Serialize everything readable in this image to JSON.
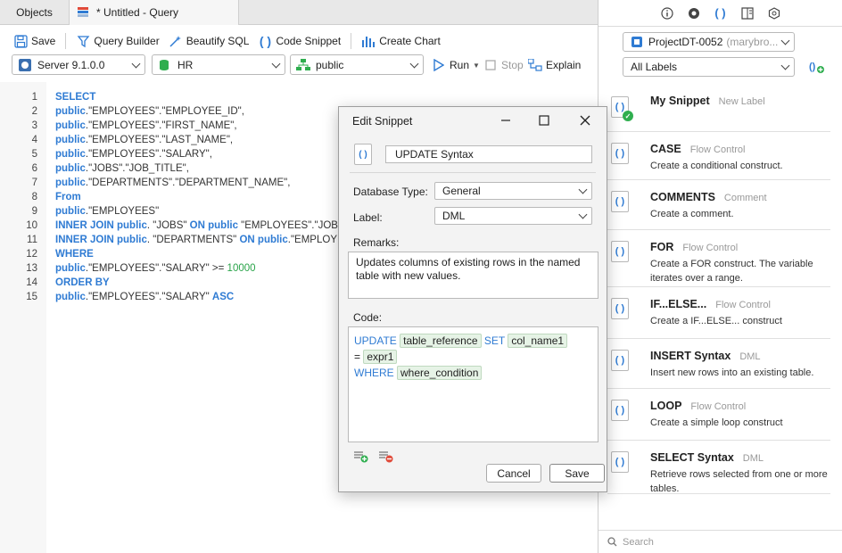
{
  "tabs": {
    "objects": "Objects",
    "query": "* Untitled - Query"
  },
  "toolbar": {
    "save": "Save",
    "query_builder": "Query Builder",
    "beautify": "Beautify SQL",
    "code_snippet": "Code Snippet",
    "create_chart": "Create Chart",
    "server": "Server 9.1.0.0",
    "database": "HR",
    "schema": "public",
    "run": "Run",
    "stop": "Stop",
    "explain": "Explain"
  },
  "editor": {
    "lines": [
      {
        "n": "1",
        "parts": [
          [
            "kw",
            "SELECT"
          ]
        ]
      },
      {
        "n": "2",
        "parts": [
          [
            "kw",
            "public"
          ],
          [
            "",
            ".\"EMPLOYEES\".\"EMPLOYEE_ID\","
          ]
        ]
      },
      {
        "n": "3",
        "parts": [
          [
            "kw",
            "public"
          ],
          [
            "",
            ".\"EMPLOYEES\".\"FIRST_NAME\","
          ]
        ]
      },
      {
        "n": "4",
        "parts": [
          [
            "kw",
            "public"
          ],
          [
            "",
            ".\"EMPLOYEES\".\"LAST_NAME\","
          ]
        ]
      },
      {
        "n": "5",
        "parts": [
          [
            "kw",
            "public"
          ],
          [
            "",
            ".\"EMPLOYEES\".\"SALARY\","
          ]
        ]
      },
      {
        "n": "6",
        "parts": [
          [
            "kw",
            "public"
          ],
          [
            "",
            ".\"JOBS\".\"JOB_TITLE\","
          ]
        ]
      },
      {
        "n": "7",
        "parts": [
          [
            "kw",
            "public"
          ],
          [
            "",
            ".\"DEPARTMENTS\".\"DEPARTMENT_NAME\","
          ]
        ]
      },
      {
        "n": "8",
        "parts": [
          [
            "kw",
            "From"
          ]
        ]
      },
      {
        "n": "9",
        "parts": [
          [
            "kw",
            "public"
          ],
          [
            "",
            ".\"EMPLOYEES\""
          ]
        ]
      },
      {
        "n": "10",
        "parts": [
          [
            "kw",
            "INNER JOIN public"
          ],
          [
            "",
            ". \"JOBS\" "
          ],
          [
            "kw",
            "ON public"
          ],
          [
            "",
            " \"EMPLOYEES\".\"JOB"
          ]
        ]
      },
      {
        "n": "11",
        "parts": [
          [
            "kw",
            "INNER JOIN public"
          ],
          [
            "",
            ". \"DEPARTMENTS\" "
          ],
          [
            "kw",
            "ON public"
          ],
          [
            "",
            ".\"EMPLOY"
          ]
        ]
      },
      {
        "n": "12",
        "parts": [
          [
            "kw",
            "WHERE"
          ]
        ]
      },
      {
        "n": "13",
        "parts": [
          [
            "kw",
            "public"
          ],
          [
            "",
            ".\"EMPLOYEES\".\"SALARY\" >= "
          ],
          [
            "num",
            "10000"
          ]
        ]
      },
      {
        "n": "14",
        "parts": [
          [
            "kw",
            "ORDER BY"
          ]
        ]
      },
      {
        "n": "15",
        "parts": [
          [
            "kw",
            "public"
          ],
          [
            "",
            ".\"EMPLOYEES\".\"SALARY\" "
          ],
          [
            "kw",
            "ASC"
          ]
        ]
      }
    ]
  },
  "dialog": {
    "title": "Edit Snippet",
    "name": "UPDATE Syntax",
    "db_type_label": "Database Type:",
    "db_type": "General",
    "label_label": "Label:",
    "label": "DML",
    "remarks_label": "Remarks:",
    "remarks": "Updates columns of existing rows in the named table with new values.",
    "code_label": "Code:",
    "code": {
      "kw_update": "UPDATE",
      "ph_table": "table_reference",
      "kw_set": "SET",
      "ph_col": "col_name1",
      "eq": "=",
      "ph_expr": "expr1",
      "kw_where": "WHERE",
      "ph_cond": "where_condition"
    },
    "cancel": "Cancel",
    "save": "Save"
  },
  "right": {
    "project": "ProjectDT-0052",
    "project_owner": "(marybro...",
    "labels": "All Labels",
    "snippets": [
      {
        "name": "My Snippet",
        "label": "New Label",
        "desc": ""
      },
      {
        "name": "CASE",
        "label": "Flow Control",
        "desc": "Create a conditional construct."
      },
      {
        "name": "COMMENTS",
        "label": "Comment",
        "desc": "Create a comment."
      },
      {
        "name": "FOR",
        "label": "Flow Control",
        "desc": "Create a FOR construct. The variable iterates over a range."
      },
      {
        "name": "IF...ELSE...",
        "label": "Flow Control",
        "desc": "Create a IF...ELSE... construct"
      },
      {
        "name": "INSERT Syntax",
        "label": "DML",
        "desc": "Insert new rows into an existing table."
      },
      {
        "name": "LOOP",
        "label": "Flow Control",
        "desc": "Create a simple loop construct"
      },
      {
        "name": "SELECT Syntax",
        "label": "DML",
        "desc": "Retrieve rows selected from one or more tables."
      }
    ],
    "search_placeholder": "Search"
  },
  "colors": {
    "accent": "#2f7bd3",
    "keyword": "#2f7bd3",
    "number": "#2aa44a",
    "placeholder_bg": "#e6f3e6"
  }
}
